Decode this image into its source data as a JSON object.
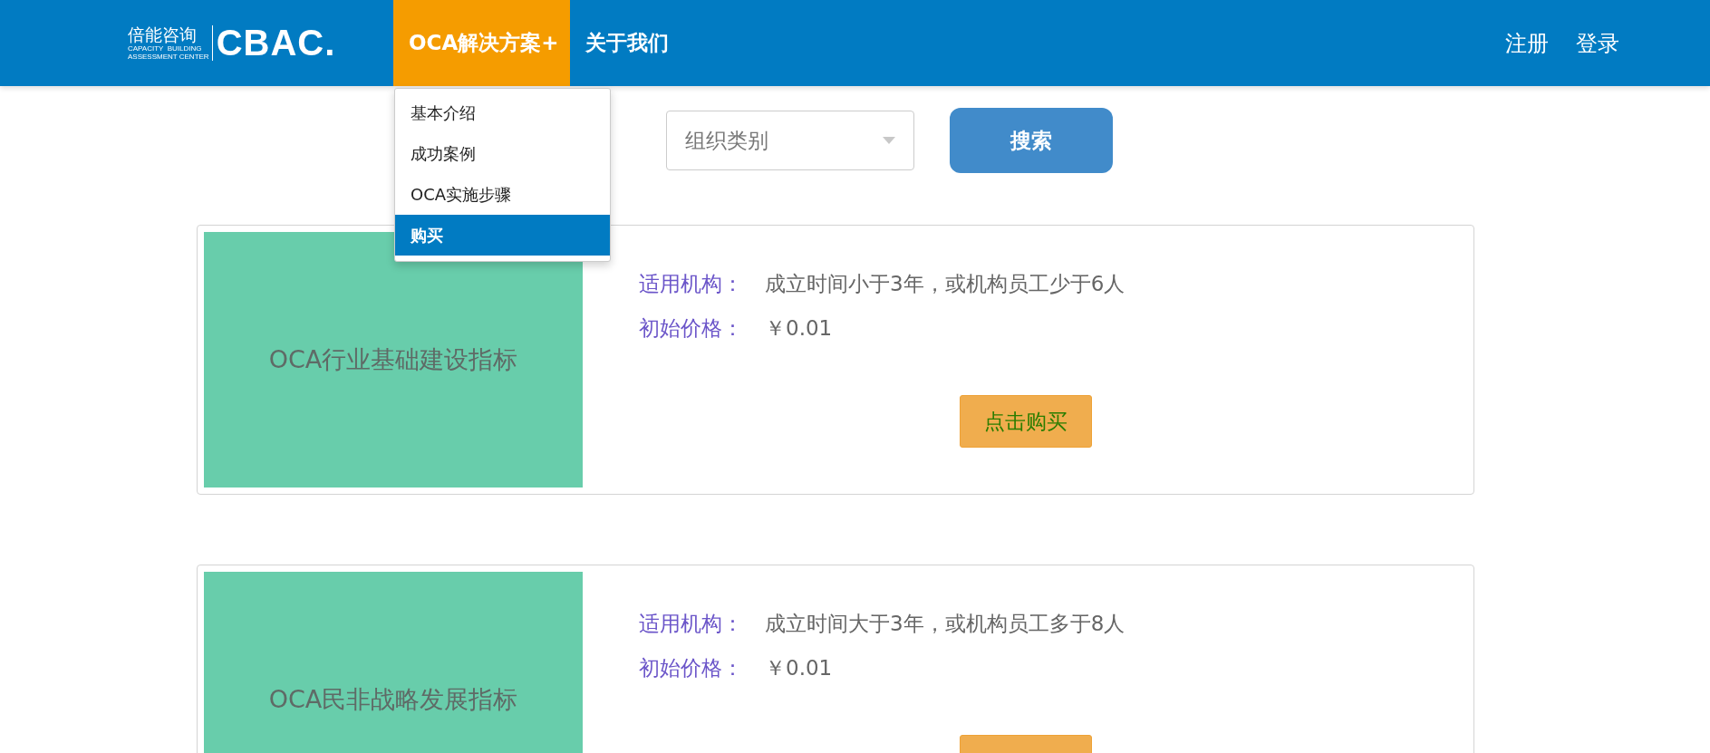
{
  "header": {
    "logo": {
      "chinese": "倍能咨询",
      "line_1": "CAPACITY  BUILDING",
      "line_2": "ASSESSMENT CENTER",
      "mark": "CBAC."
    },
    "nav": [
      {
        "label": "OCA解决方案+",
        "selected": true
      },
      {
        "label": "关于我们",
        "selected": false
      }
    ],
    "account_links": [
      "注册",
      "登录"
    ]
  },
  "dropdown": [
    {
      "label": "基本介绍",
      "selected": false
    },
    {
      "label": "成功案例",
      "selected": false
    },
    {
      "label": "OCA实施步骤",
      "selected": false
    },
    {
      "label": "购买",
      "selected": true
    }
  ],
  "filter": {
    "select_placeholder": "组织类别",
    "search_button": "搜索"
  },
  "products": [
    {
      "title": "OCA行业基础建设指标",
      "scope_label": "适用机构：",
      "scope": "成立时间小于3年，或机构员工少于6人",
      "price_label": "初始价格：",
      "price": "￥0.01",
      "buy_button": "点击购买"
    },
    {
      "title": "OCA民非战略发展指标",
      "scope_label": "适用机构：",
      "scope": "成立时间大于3年，或机构员工多于8人",
      "price_label": "初始价格：",
      "price": "￥0.01"
    }
  ]
}
